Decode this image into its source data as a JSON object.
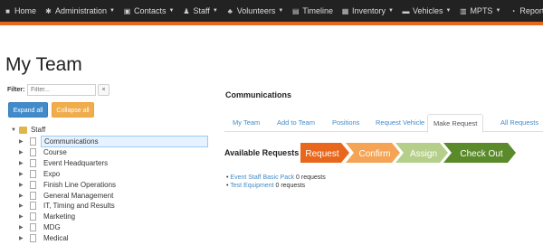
{
  "navbar": {
    "items": [
      {
        "label": "Home",
        "icon": "home-icon",
        "caret": false
      },
      {
        "label": "Administration",
        "icon": "gear-icon",
        "caret": true
      },
      {
        "label": "Contacts",
        "icon": "contacts-icon",
        "caret": true
      },
      {
        "label": "Staff",
        "icon": "staff-icon",
        "caret": true
      },
      {
        "label": "Volunteers",
        "icon": "volunteers-icon",
        "caret": true
      },
      {
        "label": "Timeline",
        "icon": "timeline-icon",
        "caret": false
      },
      {
        "label": "Inventory",
        "icon": "inventory-icon",
        "caret": true
      },
      {
        "label": "Vehicles",
        "icon": "vehicles-icon",
        "caret": true
      },
      {
        "label": "MPTS",
        "icon": "mpts-icon",
        "caret": true
      },
      {
        "label": "Reporting",
        "icon": "reporting-icon",
        "caret": true
      }
    ],
    "accent_color": "#e8671c"
  },
  "page": {
    "title": "My Team"
  },
  "filter": {
    "label": "Filter:",
    "placeholder": "Filter...",
    "clear": "×"
  },
  "buttons": {
    "expand_all": "Expand all",
    "collapse_all": "Collapse all"
  },
  "tree": {
    "root": "Staff",
    "items": [
      "Communications",
      "Course",
      "Event Headquarters",
      "Expo",
      "Finish Line Operations",
      "General Management",
      "IT, Timing and Results",
      "Marketing",
      "MDG",
      "Medical"
    ],
    "selected_index": 0
  },
  "panel": {
    "title": "Communications",
    "tabs": [
      "My Team",
      "Add to Team",
      "Positions",
      "Request Vehicle",
      "Make Request",
      "All Requests"
    ],
    "active_tab": "Make Request",
    "available_requests_label": "Available Requests",
    "steps": [
      {
        "label": "Request",
        "color": "#e8671c"
      },
      {
        "label": "Confirm",
        "color": "#f5a456"
      },
      {
        "label": "Assign",
        "color": "#b5cf8a"
      },
      {
        "label": "Check Out",
        "color": "#5a8a2a"
      }
    ],
    "requests": [
      {
        "name": "Event Staff Basic Pack",
        "count": "0 requests"
      },
      {
        "name": "Test Equipment",
        "count": "0 requests"
      }
    ]
  }
}
